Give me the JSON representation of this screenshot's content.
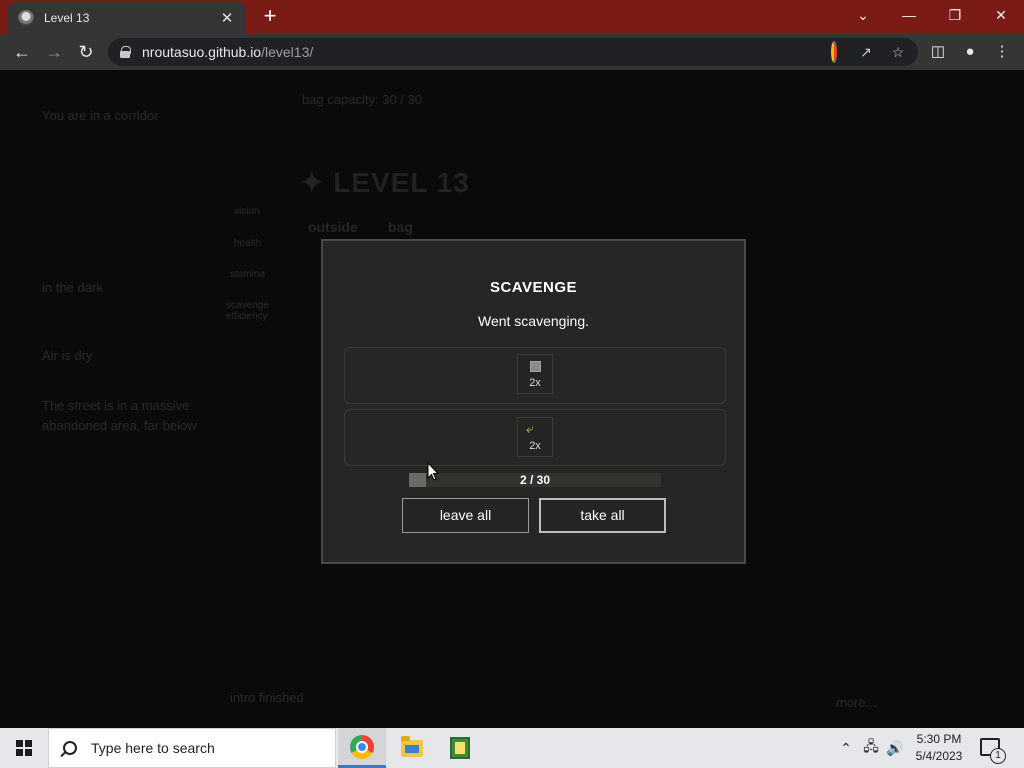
{
  "browser": {
    "tab_title": "Level 13",
    "new_tab_symbol": "+",
    "url_host": "nroutasuo.github.io",
    "url_path": "/level13/",
    "window_controls": {
      "dropdown": "⌄",
      "minimize": "—",
      "restore": "❐",
      "close": "✕"
    }
  },
  "background_page": {
    "bag_capacity": "bag capacity: 30 / 30",
    "logo_text": "LEVEL 13",
    "tabs": [
      "outside",
      "bag"
    ],
    "stats": [
      "vision",
      "health",
      "stamina",
      "scavenge efficiency"
    ],
    "log": [
      "You are in a corridor",
      "in the dark",
      "Air is dry",
      "The street is in a massive",
      "abandoned area, far below"
    ],
    "footer_left": "intro finished",
    "footer_right": "more..."
  },
  "modal": {
    "title": "SCAVENGE",
    "description": "Went scavenging.",
    "rows": [
      {
        "icon": "gray-box-icon",
        "count": "2x"
      },
      {
        "icon": "arrow-icon",
        "count": "2x"
      }
    ],
    "bag_text": "2 / 30",
    "bag_fill_fraction": 0.067,
    "leave_all_label": "leave all",
    "take_all_label": "take all"
  },
  "taskbar": {
    "search_placeholder": "Type here to search",
    "time": "5:30 PM",
    "date": "5/4/2023",
    "notification_count": "1"
  }
}
